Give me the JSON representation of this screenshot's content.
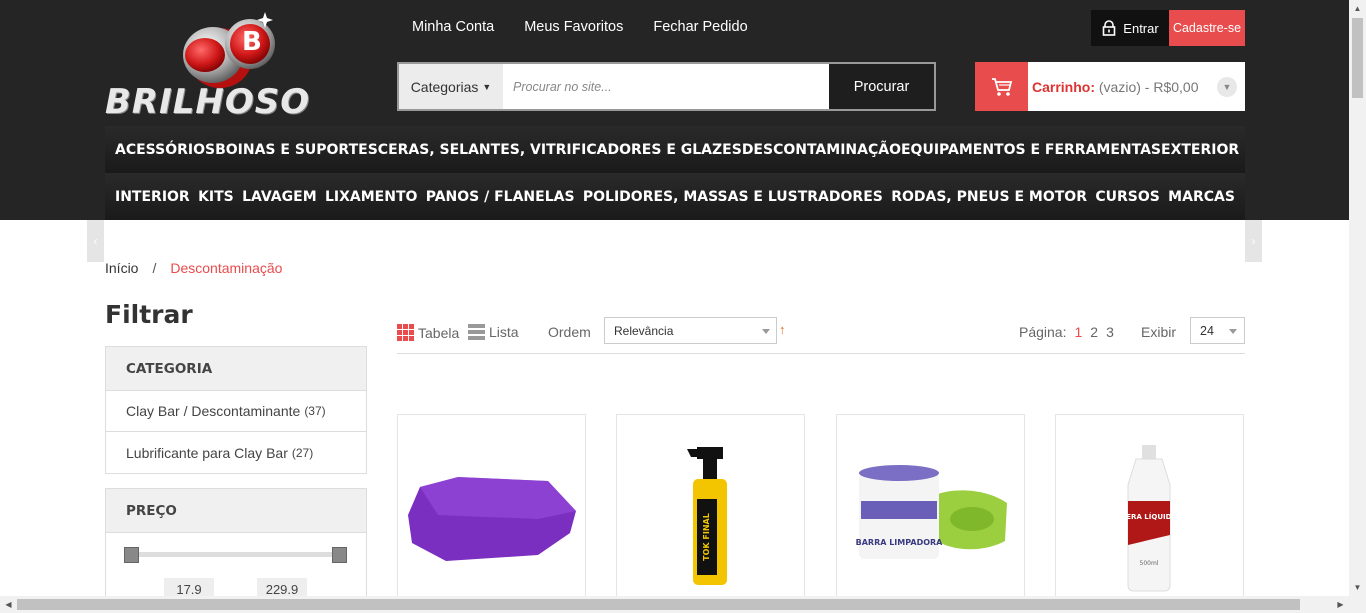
{
  "brand": {
    "name": "BRILHOSO",
    "badge_letter": "B"
  },
  "top_links": [
    "Minha Conta",
    "Meus Favoritos",
    "Fechar Pedido"
  ],
  "account": {
    "login_label": "Entrar",
    "signup_label": "Cadastre-se"
  },
  "search": {
    "category_label": "Categorias",
    "placeholder": "Procurar no site...",
    "button_label": "Procurar"
  },
  "cart": {
    "label": "Carrinho:",
    "status": "(vazio) - R$0,00"
  },
  "nav": {
    "row1": [
      "ACESSÓRIOS",
      "BOINAS E SUPORTES",
      "CERAS, SELANTES, VITRIFICADORES E GLAZES",
      "DESCONTAMINAÇÃO",
      "EQUIPAMENTOS E FERRAMENTAS",
      "EXTERIOR"
    ],
    "row2": [
      "INTERIOR",
      "KITS",
      "LAVAGEM",
      "LIXAMENTO",
      "PANOS / FLANELAS",
      "POLIDORES, MASSAS E LUSTRADORES",
      "RODAS, PNEUS E MOTOR",
      "CURSOS",
      "MARCAS"
    ]
  },
  "breadcrumb": {
    "home": "Início",
    "separator": "/",
    "current": "Descontaminação"
  },
  "filter": {
    "title": "Filtrar",
    "category": {
      "heading": "CATEGORIA",
      "items": [
        {
          "label": "Clay Bar / Descontaminante",
          "count": "(37)"
        },
        {
          "label": "Lubrificante para Clay Bar",
          "count": "(27)"
        }
      ]
    },
    "price": {
      "heading": "PREÇO",
      "min": "17.9",
      "max": "229.9"
    }
  },
  "toolbar": {
    "view_table": "Tabela",
    "view_list": "Lista",
    "order_label": "Ordem",
    "order_value": "Relevância",
    "page_label": "Página:",
    "pages": [
      "1",
      "2",
      "3"
    ],
    "current_page": "1",
    "show_label": "Exibir",
    "show_value": "24"
  },
  "product_images": {
    "p2_label": "TOK FINAL",
    "p3_label": "BARRA LIMPADORA",
    "p4_label": "CERA LÍQUIDA",
    "p4_volume": "500ml"
  },
  "colors": {
    "accent": "#e84c4c",
    "header_bg": "#252525",
    "nav_bg": "#1b1b1b"
  },
  "icons": [
    "lock-icon",
    "cart-icon",
    "chevron-down-icon",
    "grid-icon",
    "list-icon",
    "sort-arrow-icon"
  ]
}
